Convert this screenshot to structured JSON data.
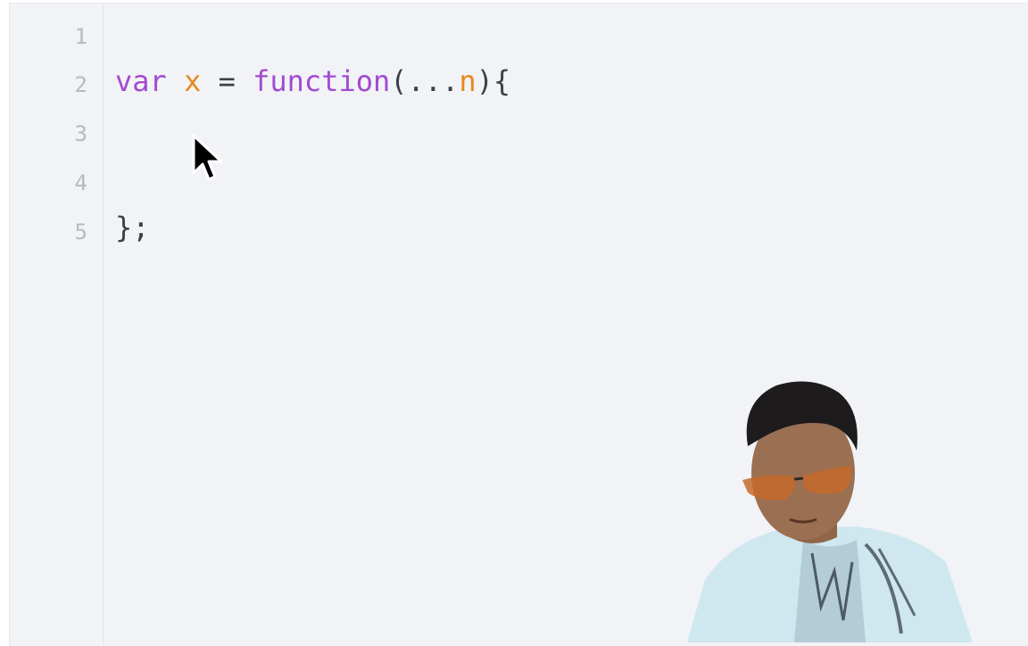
{
  "editor": {
    "line_numbers": [
      "1",
      "2",
      "3",
      "4",
      "5"
    ],
    "lines": [
      [],
      [
        {
          "text": "var",
          "kind": "keyword"
        },
        {
          "text": " ",
          "kind": "plain"
        },
        {
          "text": "x",
          "kind": "var"
        },
        {
          "text": " = ",
          "kind": "plain"
        },
        {
          "text": "function",
          "kind": "keyword"
        },
        {
          "text": "(...",
          "kind": "plain"
        },
        {
          "text": "n",
          "kind": "var"
        },
        {
          "text": "){",
          "kind": "plain"
        }
      ],
      [],
      [],
      [
        {
          "text": "};",
          "kind": "plain"
        }
      ]
    ]
  },
  "colors": {
    "editor_background": "#f1f3f6",
    "keyword": "#a24ad1",
    "variable": "#e8881d",
    "plain_text": "#3c4048",
    "line_number": "#b6bac1"
  },
  "overlays": {
    "pointer_icon": "mouse-pointer-icon",
    "webcam": "presenter-webcam-overlay"
  }
}
